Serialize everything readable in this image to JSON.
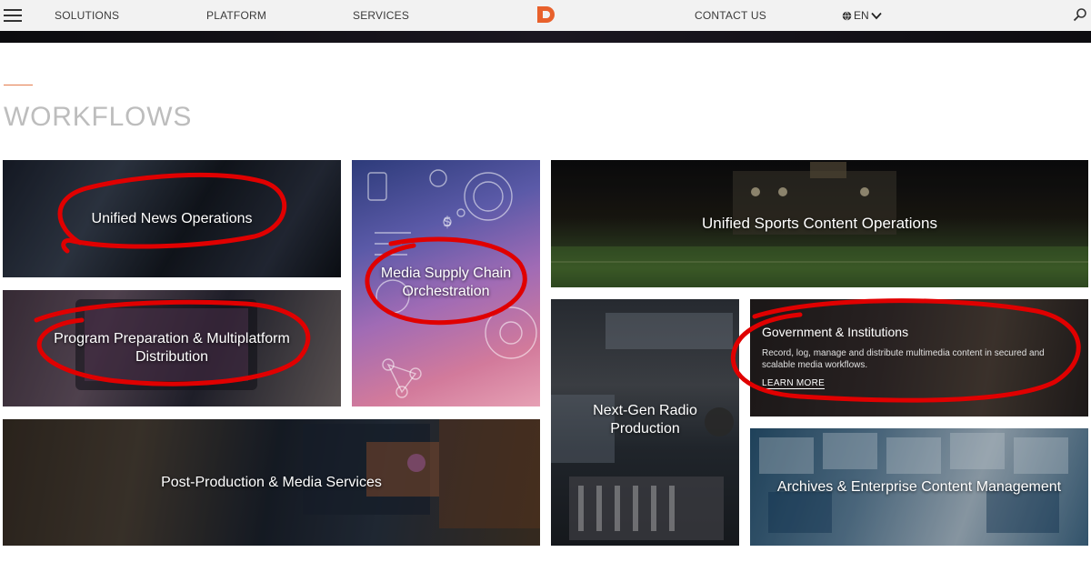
{
  "nav": {
    "menu_icon": "hamburger-menu-icon",
    "solutions": "SOLUTIONS",
    "platform": "PLATFORM",
    "services": "SERVICES",
    "logo_icon": "dalet-logo-icon",
    "contact": "CONTACT US",
    "language": "EN",
    "globe_icon": "globe-icon",
    "chevron_icon": "chevron-down-icon",
    "search_icon": "search-icon"
  },
  "section": {
    "title": "WORKFLOWS"
  },
  "tiles": {
    "news": "Unified News Operations",
    "supply": "Media Supply Chain Orchestration",
    "sports": "Unified Sports Content Operations",
    "program": "Program Preparation & Multiplatform Distribution",
    "radio": "Next-Gen Radio Production",
    "government": {
      "title": "Government & Institutions",
      "description": "Record, log, manage and distribute multimedia content in secured and scalable media workflows.",
      "link": "LEARN MORE"
    },
    "post": "Post-Production & Media Services",
    "archives": "Archives & Enterprise Content Management"
  },
  "colors": {
    "accent": "#e47b4c",
    "logo": "#e8612c",
    "annotation": "#e00000",
    "nav_bg": "#f2f2f2"
  }
}
